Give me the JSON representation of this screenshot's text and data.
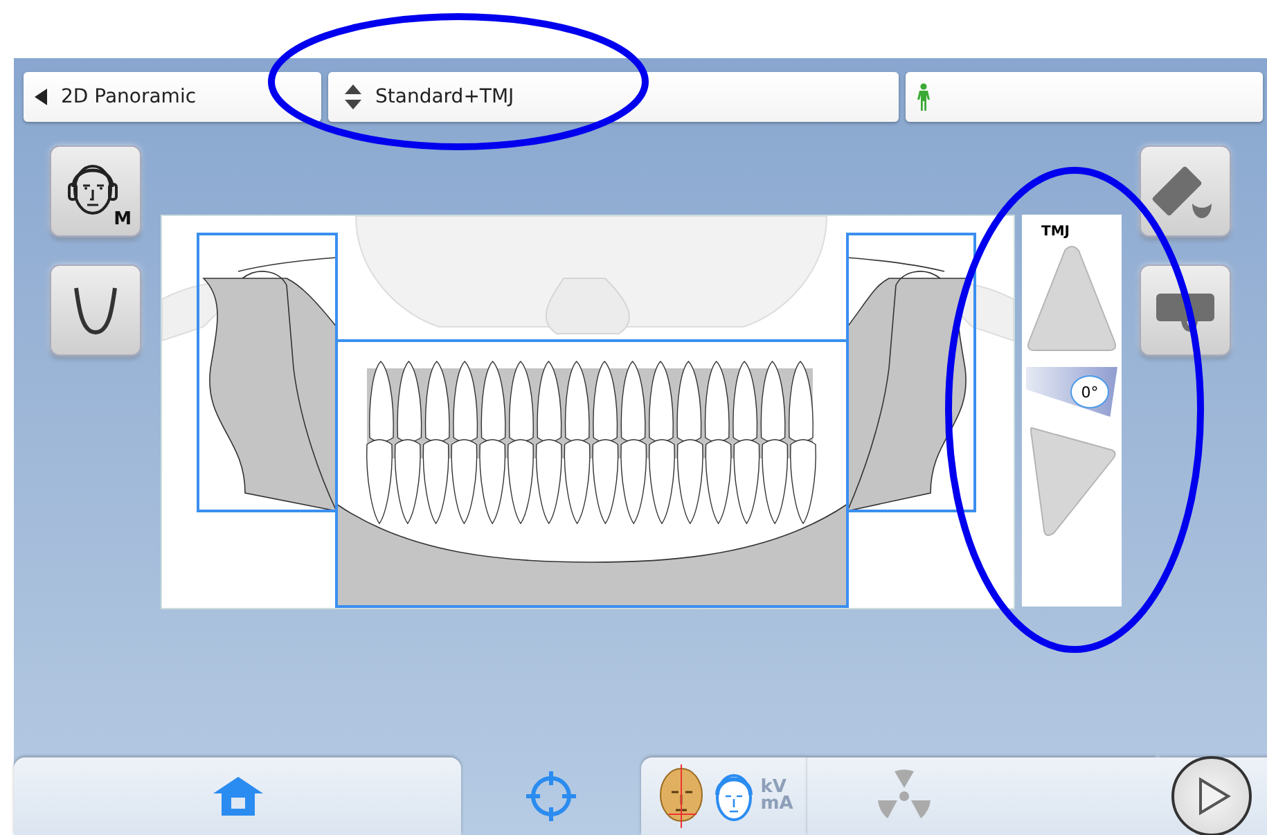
{
  "top_bar": {
    "program": {
      "label": "2D Panoramic"
    },
    "variant": {
      "label": "Standard+TMJ"
    }
  },
  "face_button": {
    "badge": "M"
  },
  "tmj_panel": {
    "title": "TMJ",
    "angle": "0°"
  },
  "tabs": [
    {
      "kind": "home",
      "selected": false
    },
    {
      "kind": "positioning",
      "selected": true
    },
    {
      "kind": "parameters",
      "selected": false,
      "labels": [
        "kV",
        "mA"
      ]
    },
    {
      "kind": "exposure",
      "selected": false
    }
  ]
}
